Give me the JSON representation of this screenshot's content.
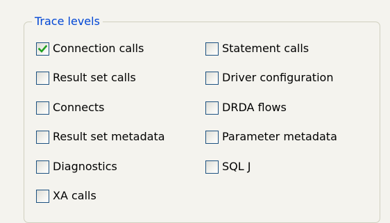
{
  "group": {
    "title": "Trace levels"
  },
  "options": {
    "connection_calls": {
      "label": "Connection calls",
      "checked": true
    },
    "statement_calls": {
      "label": "Statement calls",
      "checked": false
    },
    "result_set_calls": {
      "label": "Result set calls",
      "checked": false
    },
    "driver_configuration": {
      "label": "Driver configuration",
      "checked": false
    },
    "connects": {
      "label": "Connects",
      "checked": false
    },
    "drda_flows": {
      "label": "DRDA flows",
      "checked": false
    },
    "result_set_metadata": {
      "label": "Result set metadata",
      "checked": false
    },
    "parameter_metadata": {
      "label": "Parameter metadata",
      "checked": false
    },
    "diagnostics": {
      "label": "Diagnostics",
      "checked": false
    },
    "sql_j": {
      "label": "SQL J",
      "checked": false
    },
    "xa_calls": {
      "label": "XA calls",
      "checked": false
    }
  },
  "colors": {
    "legend_text": "#0046d5",
    "checkbox_border": "#1c5180",
    "checkmark": "#21a121",
    "background": "#f4f3ee"
  }
}
